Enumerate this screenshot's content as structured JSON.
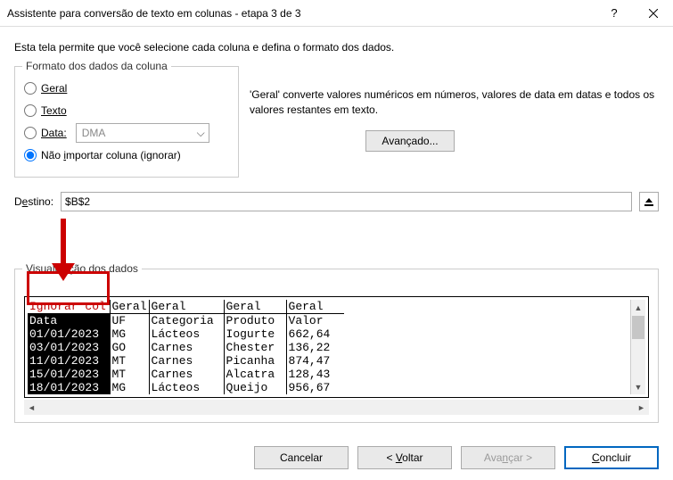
{
  "window": {
    "title": "Assistente para conversão de texto em colunas - etapa 3 de 3",
    "help_glyph": "?",
    "close_glyph": "✕"
  },
  "intro": "Esta tela permite que você selecione cada coluna e defina o formato dos dados.",
  "format_group": {
    "legend": "Formato dos dados da coluna",
    "general_label": "Geral",
    "text_label": "Texto",
    "date_label": "Data:",
    "date_value": "DMA",
    "skip_label": "Não importar coluna (ignorar)"
  },
  "right": {
    "description": "'Geral' converte valores numéricos em números, valores de data em datas e todos os valores restantes em texto.",
    "advanced_label": "Avançado..."
  },
  "destination": {
    "label": "Destino:",
    "value": "$B$2"
  },
  "preview": {
    "legend": "Visualização dos dados",
    "headers": [
      "Ignorar col",
      "Geral",
      "Geral",
      "Geral",
      "Geral"
    ],
    "rows": [
      [
        "Data",
        "UF",
        "Categoria",
        "Produto",
        "Valor"
      ],
      [
        "01/01/2023",
        "MG",
        "Lácteos",
        "Iogurte",
        "662,64"
      ],
      [
        "03/01/2023",
        "GO",
        "Carnes",
        "Chester",
        "136,22"
      ],
      [
        "11/01/2023",
        "MT",
        "Carnes",
        "Picanha",
        "874,47"
      ],
      [
        "15/01/2023",
        "MT",
        "Carnes",
        "Alcatra",
        "128,43"
      ],
      [
        "18/01/2023",
        "MG",
        "Lácteos",
        "Queijo",
        "956,67"
      ]
    ]
  },
  "buttons": {
    "cancel": "Cancelar",
    "back": "< Voltar",
    "next": "Avançar >",
    "finish": "Concluir"
  },
  "chart_data": {
    "type": "table",
    "title": "Visualização dos dados",
    "columns": [
      "Data",
      "UF",
      "Categoria",
      "Produto",
      "Valor"
    ],
    "column_formats": [
      "Ignorar coluna",
      "Geral",
      "Geral",
      "Geral",
      "Geral"
    ],
    "rows": [
      {
        "Data": "01/01/2023",
        "UF": "MG",
        "Categoria": "Lácteos",
        "Produto": "Iogurte",
        "Valor": 662.64
      },
      {
        "Data": "03/01/2023",
        "UF": "GO",
        "Categoria": "Carnes",
        "Produto": "Chester",
        "Valor": 136.22
      },
      {
        "Data": "11/01/2023",
        "UF": "MT",
        "Categoria": "Carnes",
        "Produto": "Picanha",
        "Valor": 874.47
      },
      {
        "Data": "15/01/2023",
        "UF": "MT",
        "Categoria": "Carnes",
        "Produto": "Alcatra",
        "Valor": 128.43
      },
      {
        "Data": "18/01/2023",
        "UF": "MG",
        "Categoria": "Lácteos",
        "Produto": "Queijo",
        "Valor": 956.67
      }
    ]
  }
}
